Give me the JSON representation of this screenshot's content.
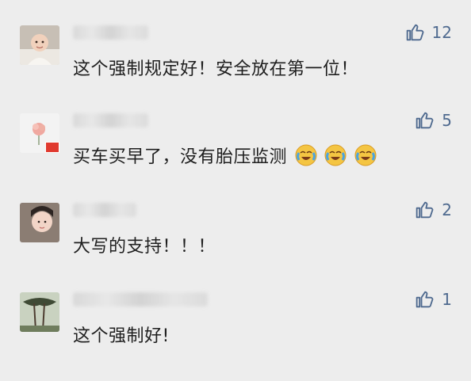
{
  "comments": [
    {
      "text": "这个强制规定好！安全放在第一位！",
      "likes": "12"
    },
    {
      "text": "买车买早了，没有胎压监测",
      "likes": "5",
      "emoji_count": 3
    },
    {
      "text": "大写的支持！！！",
      "likes": "2"
    },
    {
      "text": "这个强制好!",
      "likes": "1"
    }
  ],
  "icons": {
    "like": "thumbs-up-icon",
    "emoji": "laughing-crying-emoji"
  },
  "colors": {
    "background": "#ededed",
    "like": "#4f6a8f",
    "text": "#1f1f1f"
  }
}
